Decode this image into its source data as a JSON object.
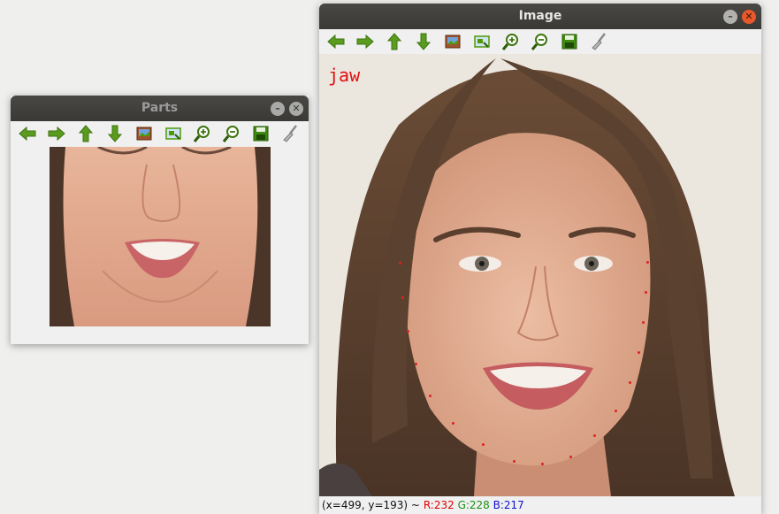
{
  "windows": {
    "image": {
      "title": "Image",
      "overlay_label": "jaw",
      "status": {
        "coords": "(x=499, y=193) ~",
        "r": "R:232",
        "g": "G:228",
        "b": "B:217"
      }
    },
    "parts": {
      "title": "Parts"
    }
  },
  "toolbar_icons": [
    "arrow-left-icon",
    "arrow-right-icon",
    "arrow-up-icon",
    "arrow-down-icon",
    "image-icon",
    "zoom-fit-icon",
    "zoom-in-icon",
    "zoom-out-icon",
    "save-icon",
    "brush-icon"
  ],
  "colors": {
    "accent_green": "#4e9a06",
    "status_r": "#e00000",
    "status_g": "#1a8f1a",
    "status_b": "#1010d0",
    "overlay_red": "#e01010",
    "titlebar_close": "#e8582b"
  }
}
